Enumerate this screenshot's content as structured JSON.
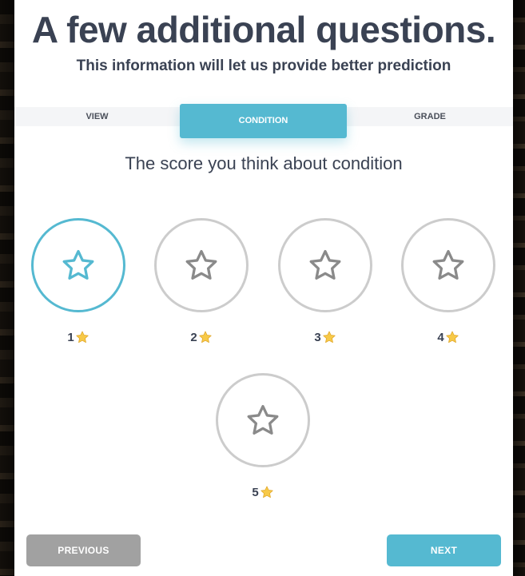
{
  "header": {
    "title": "A few additional questions.",
    "subtitle": "This information will let us provide better prediction"
  },
  "tabs": [
    {
      "label": "VIEW",
      "active": false
    },
    {
      "label": "CONDITION",
      "active": true
    },
    {
      "label": "GRADE",
      "active": false
    }
  ],
  "question": "The score you think about condition",
  "rating": {
    "selected": 1,
    "max": 5,
    "options": [
      {
        "value": "1",
        "icon": "star-icon"
      },
      {
        "value": "2",
        "icon": "star-icon"
      },
      {
        "value": "3",
        "icon": "star-icon"
      },
      {
        "value": "4",
        "icon": "star-icon"
      },
      {
        "value": "5",
        "icon": "star-icon"
      }
    ]
  },
  "buttons": {
    "previous": "PREVIOUS",
    "next": "NEXT"
  },
  "colors": {
    "accent": "#55b9d1",
    "disabled": "#a1a1a1",
    "text": "#3a4253",
    "ring": "#cccccc"
  }
}
